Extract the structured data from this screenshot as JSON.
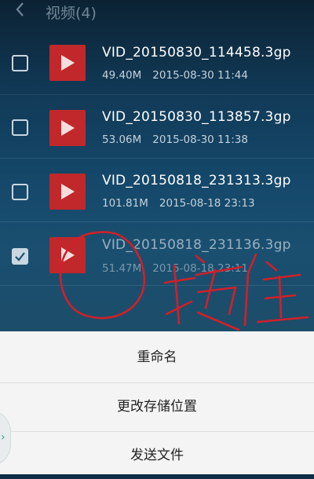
{
  "header": {
    "title": "视频(4)"
  },
  "files": [
    {
      "name": "VID_20150830_114458.3gp",
      "size": "49.40M",
      "date": "2015-08-30 11:44",
      "checked": false
    },
    {
      "name": "VID_20150830_113857.3gp",
      "size": "53.06M",
      "date": "2015-08-30 11:38",
      "checked": false
    },
    {
      "name": "VID_20150818_231313.3gp",
      "size": "101.81M",
      "date": "2015-08-18 23:13",
      "checked": false
    },
    {
      "name": "VID_20150818_231136.3gp",
      "size": "51.47M",
      "date": "2015-08-18 23:11",
      "checked": true
    }
  ],
  "annotation": {
    "handwriting": "按住",
    "color": "#d0202a"
  },
  "context_menu": {
    "rename": "重命名",
    "change_location": "更改存储位置",
    "send_file": "发送文件"
  },
  "colors": {
    "thumb": "#c1282b",
    "checkbox": "#c9d7e1",
    "sheet": "#f4f4f4"
  }
}
